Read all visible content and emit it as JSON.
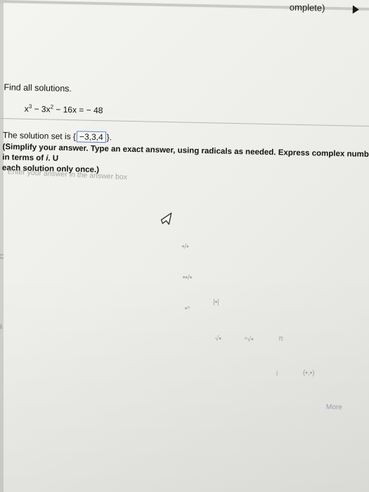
{
  "header": {
    "status": "omplete)"
  },
  "question": {
    "prompt": "Find all solutions.",
    "equation": {
      "x_exp": "3",
      "x2_exp": "2",
      "x_base": "x",
      "mid": " − 3x",
      "tail": " − 16x = − 48"
    }
  },
  "answer": {
    "prefix": "The solution set is {",
    "value": "−3,3,4",
    "suffix": "}.",
    "instructions_line1": "(Simplify your answer. Type an exact answer, using radicals as needed. Express complex numbers in terms of ",
    "i_symbol": "i",
    "instructions_line1_end": ". U",
    "instructions_line2": "each solution only once.)"
  },
  "input_area": {
    "hint": "Enter your answer in the answer box"
  },
  "toolbar": {
    "tools": [
      {
        "label": "▪/▪",
        "icon": "fraction-icon"
      },
      {
        "label": "▪▪/▪",
        "icon": "mixed-number-icon"
      },
      {
        "label": "▪ⁿ",
        "icon": "exponent-icon"
      },
      {
        "label": "|▪|",
        "icon": "absolute-value-icon"
      },
      {
        "label": "√▪",
        "icon": "square-root-icon"
      },
      {
        "label": "ⁿ√▪",
        "icon": "nth-root-icon"
      },
      {
        "label": "π",
        "icon": "pi-icon"
      },
      {
        "label": "i",
        "icon": "imaginary-unit-icon"
      },
      {
        "label": "(▪,▪)",
        "icon": "interval-icon"
      },
      {
        "label": "More",
        "icon": "more-icon"
      }
    ]
  }
}
